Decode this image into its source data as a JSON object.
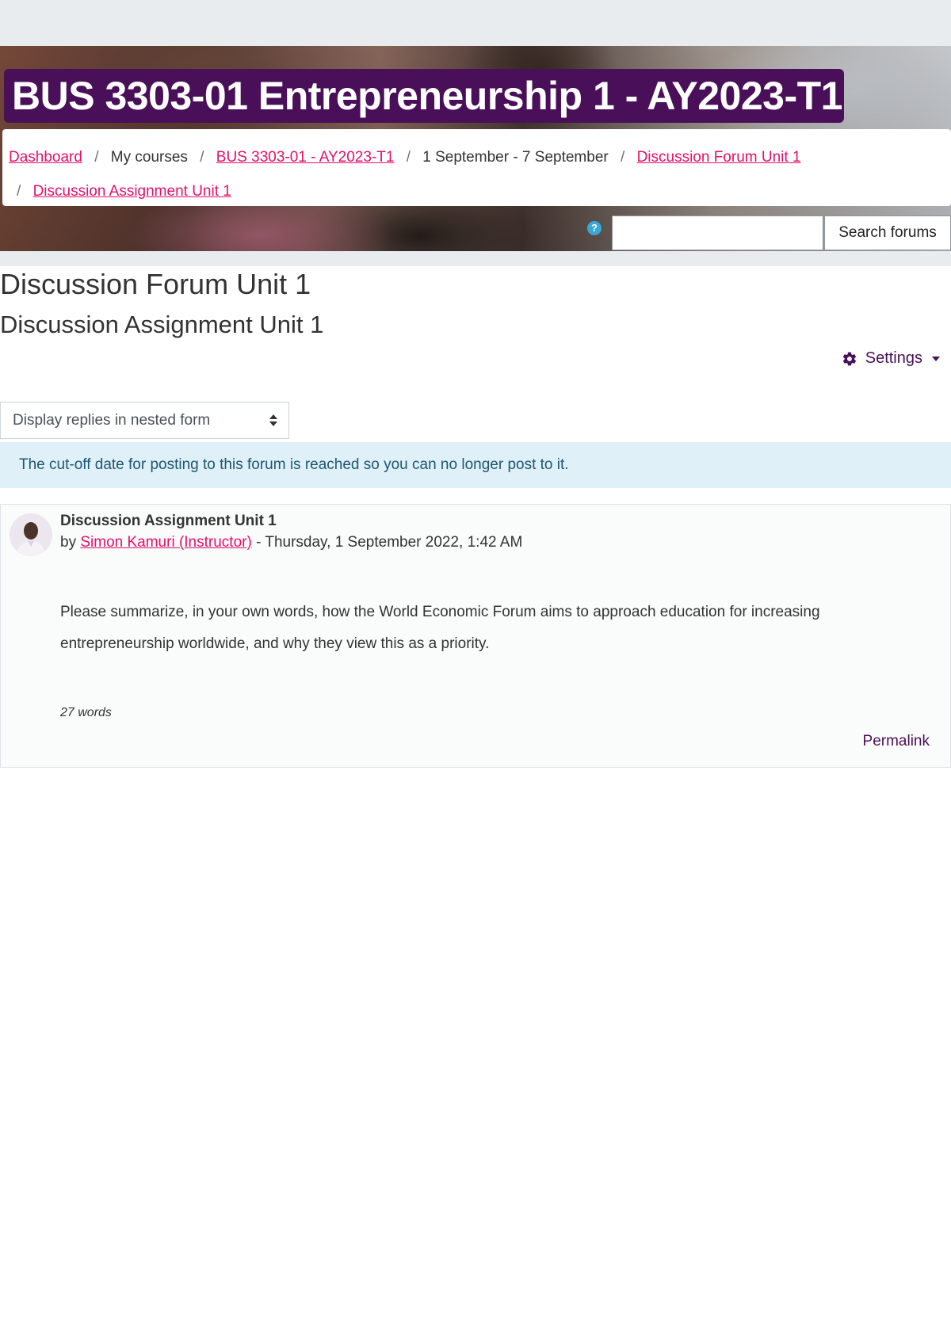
{
  "course": {
    "title": "BUS 3303-01 Entrepreneurship 1 - AY2023-T1"
  },
  "breadcrumb": {
    "items": [
      {
        "label": "Dashboard"
      },
      {
        "label": "My courses"
      },
      {
        "label": "BUS 3303-01 - AY2023-T1"
      },
      {
        "label": "1 September - 7 September"
      },
      {
        "label": "Discussion Forum Unit 1"
      },
      {
        "label": "Discussion Assignment Unit 1"
      }
    ],
    "separator": "/"
  },
  "search": {
    "input_value": "",
    "button_label": "Search forums",
    "help_icon": "question-circle-icon"
  },
  "page": {
    "heading": "Discussion Forum Unit 1",
    "subheading": "Discussion Assignment Unit 1"
  },
  "settings": {
    "label": "Settings",
    "icon": "gear-icon"
  },
  "display_mode": {
    "selected": "Display replies in nested form"
  },
  "alert": {
    "text": "The cut-off date for posting to this forum is reached so you can no longer post to it."
  },
  "post": {
    "subject": "Discussion Assignment Unit 1",
    "by_prefix": "by",
    "author": "Simon Kamuri (Instructor)",
    "date_text": " - Thursday, 1 September 2022, 1:42 AM",
    "body": "Please summarize, in your own words, how the World Economic Forum aims to approach education for increasing entrepreneurship worldwide, and why they view this as a priority.",
    "word_count": "27 words",
    "permalink": "Permalink"
  },
  "colors": {
    "brand_purple": "#4a0f59",
    "link_pink": "#e5106b",
    "alert_bg": "#dff0f8",
    "alert_text": "#1e5770"
  }
}
